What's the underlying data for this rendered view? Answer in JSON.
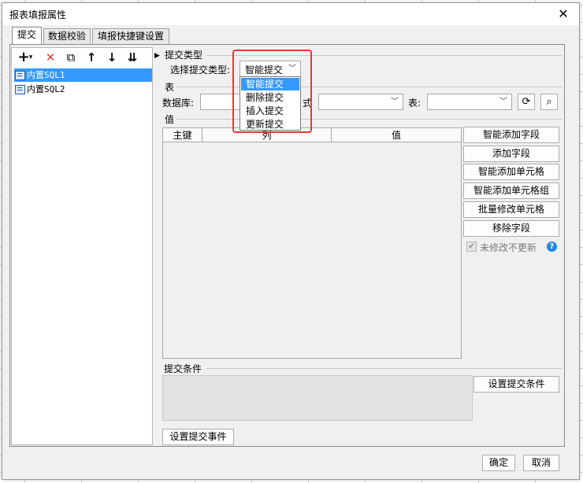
{
  "window": {
    "title": "报表填报属性",
    "close_glyph": "✕"
  },
  "tabs": [
    {
      "label": "提交"
    },
    {
      "label": "数据校验"
    },
    {
      "label": "填报快捷键设置"
    }
  ],
  "toolbar": {
    "add": "+",
    "add_caret": "▾",
    "delete": "✕",
    "copy": "⧉",
    "up": "↑",
    "down": "↓",
    "bottom": "⇊"
  },
  "tree": {
    "items": [
      {
        "label": "内置SQL1",
        "selected": true
      },
      {
        "label": "内置SQL2",
        "selected": false
      }
    ]
  },
  "submit_type": {
    "section": "提交类型",
    "label": "选择提交类型:",
    "value": "智能提交",
    "options": [
      "智能提交",
      "删除提交",
      "插入提交",
      "更新提交"
    ]
  },
  "table_section": {
    "section": "表",
    "db_label": "数据库:",
    "mode_label": "式",
    "table_label": "表:",
    "db_value": "",
    "mode_value": "",
    "table_value": ""
  },
  "values_section": {
    "section": "值",
    "columns": [
      "主键",
      "列",
      "值"
    ]
  },
  "side_buttons": [
    "智能添加字段",
    "添加字段",
    "智能添加单元格",
    "智能添加单元格组",
    "批量修改单元格",
    "移除字段"
  ],
  "option": {
    "label": "未修改不更新",
    "checked": true,
    "help": "?"
  },
  "conditions": {
    "section": "提交条件",
    "button": "设置提交条件"
  },
  "event_button": "设置提交事件",
  "footer": {
    "ok": "确定",
    "cancel": "取消"
  },
  "colors": {
    "selection": "#3399ff",
    "highlight_border": "#e53935",
    "help_icon": "#1e88e5",
    "delete_icon": "#e53935"
  }
}
